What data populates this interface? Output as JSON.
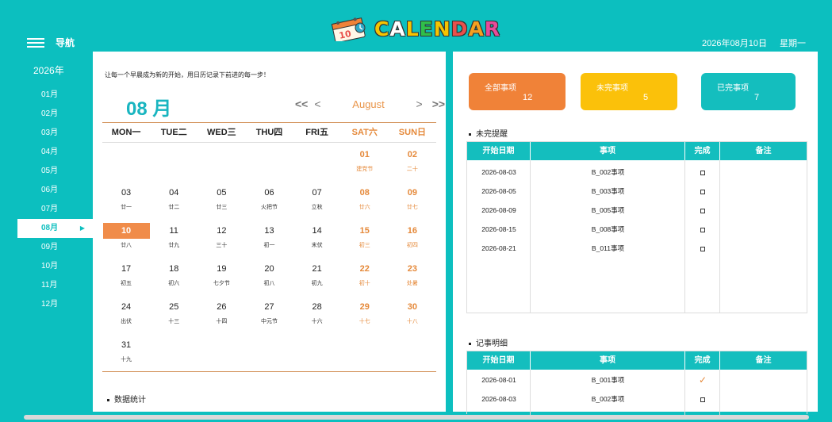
{
  "header": {
    "nav_label": "导航",
    "logo_letters": [
      {
        "ch": "C",
        "color": "#f5c400"
      },
      {
        "ch": "A",
        "color": "#ffffff"
      },
      {
        "ch": "L",
        "color": "#f5c400"
      },
      {
        "ch": "E",
        "color": "#2fbf4a"
      },
      {
        "ch": "N",
        "color": "#f5c400"
      },
      {
        "ch": "D",
        "color": "#e8504b"
      },
      {
        "ch": "A",
        "color": "#f5a020"
      },
      {
        "ch": "R",
        "color": "#e84a9a"
      }
    ],
    "date": "2026年08月10日",
    "weekday": "星期一"
  },
  "sidebar": {
    "year": "2026年",
    "months": [
      "01月",
      "02月",
      "03月",
      "04月",
      "05月",
      "06月",
      "07月",
      "08月",
      "09月",
      "10月",
      "11月",
      "12月"
    ],
    "active_index": 7,
    "active_arrow": "▶"
  },
  "calendar": {
    "slogan": "让每一个早晨成为新的开始，用日历记录下前进的每一步！",
    "big_month": "08 月",
    "nav": {
      "first": "<<",
      "prev": "<",
      "month_name": "August",
      "next": ">",
      "last": ">>"
    },
    "weekdays": [
      "MON一",
      "TUE二",
      "WED三",
      "THU四",
      "FRI五",
      "SAT六",
      "SUN日"
    ],
    "rows": [
      [
        null,
        null,
        null,
        null,
        null,
        {
          "d": "01",
          "l": "建党节"
        },
        {
          "d": "02",
          "l": "二十"
        }
      ],
      [
        {
          "d": "03",
          "l": "廿一"
        },
        {
          "d": "04",
          "l": "廿二"
        },
        {
          "d": "05",
          "l": "廿三"
        },
        {
          "d": "06",
          "l": "火把节"
        },
        {
          "d": "07",
          "l": "立秋"
        },
        {
          "d": "08",
          "l": "廿六"
        },
        {
          "d": "09",
          "l": "廿七"
        }
      ],
      [
        {
          "d": "10",
          "l": "廿八",
          "today": true
        },
        {
          "d": "11",
          "l": "廿九"
        },
        {
          "d": "12",
          "l": "三十"
        },
        {
          "d": "13",
          "l": "初一"
        },
        {
          "d": "14",
          "l": "末伏"
        },
        {
          "d": "15",
          "l": "初三"
        },
        {
          "d": "16",
          "l": "初四"
        }
      ],
      [
        {
          "d": "17",
          "l": "初五"
        },
        {
          "d": "18",
          "l": "初六"
        },
        {
          "d": "19",
          "l": "七夕节"
        },
        {
          "d": "20",
          "l": "初八"
        },
        {
          "d": "21",
          "l": "初九"
        },
        {
          "d": "22",
          "l": "初十"
        },
        {
          "d": "23",
          "l": "处暑"
        }
      ],
      [
        {
          "d": "24",
          "l": "出伏"
        },
        {
          "d": "25",
          "l": "十三"
        },
        {
          "d": "26",
          "l": "十四"
        },
        {
          "d": "27",
          "l": "中元节"
        },
        {
          "d": "28",
          "l": "十六"
        },
        {
          "d": "29",
          "l": "十七"
        },
        {
          "d": "30",
          "l": "十八"
        }
      ],
      [
        {
          "d": "31",
          "l": "十九"
        },
        null,
        null,
        null,
        null,
        null,
        null
      ]
    ],
    "stats_heading": "数据统计"
  },
  "cards": [
    {
      "title": "全部事项",
      "count": "12",
      "color": "#f08238"
    },
    {
      "title": "未完事项",
      "count": "5",
      "color": "#fbc10a"
    },
    {
      "title": "已完事项",
      "count": "7",
      "color": "#14bebe"
    }
  ],
  "pending": {
    "heading": "未完提醒",
    "headers": [
      "开始日期",
      "事项",
      "完成",
      "备注"
    ],
    "rows": [
      {
        "date": "2026-08-03",
        "item": "B_002事项",
        "done": false
      },
      {
        "date": "2026-08-05",
        "item": "B_003事项",
        "done": false
      },
      {
        "date": "2026-08-09",
        "item": "B_005事项",
        "done": false
      },
      {
        "date": "2026-08-15",
        "item": "B_008事项",
        "done": false
      },
      {
        "date": "2026-08-21",
        "item": "B_011事项",
        "done": false
      }
    ]
  },
  "details": {
    "heading": "记事明细",
    "headers": [
      "开始日期",
      "事项",
      "完成",
      "备注"
    ],
    "rows": [
      {
        "date": "2026-08-01",
        "item": "B_001事项",
        "done": true,
        "mark": "✓"
      },
      {
        "date": "2026-08-03",
        "item": "B_002事项",
        "done": false
      }
    ]
  }
}
